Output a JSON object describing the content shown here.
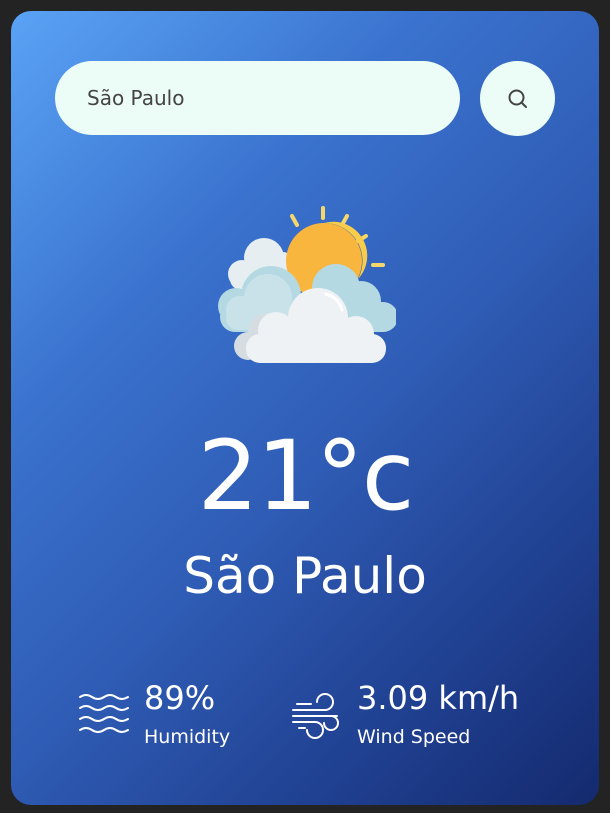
{
  "search": {
    "value": "São Paulo",
    "icon": "search-icon"
  },
  "weather": {
    "icon": "partly-cloudy-sun-icon",
    "temperature": "21°c",
    "city": "São Paulo"
  },
  "details": {
    "humidity": {
      "icon": "waves-icon",
      "value": "89%",
      "label": "Humidity"
    },
    "wind": {
      "icon": "wind-icon",
      "value": "3.09 km/h",
      "label": "Wind Speed"
    }
  },
  "colors": {
    "card_gradient_start": "#5aa3f5",
    "card_gradient_end": "#142a6e",
    "input_background": "#ecfdf7",
    "text": "#ffffff"
  }
}
